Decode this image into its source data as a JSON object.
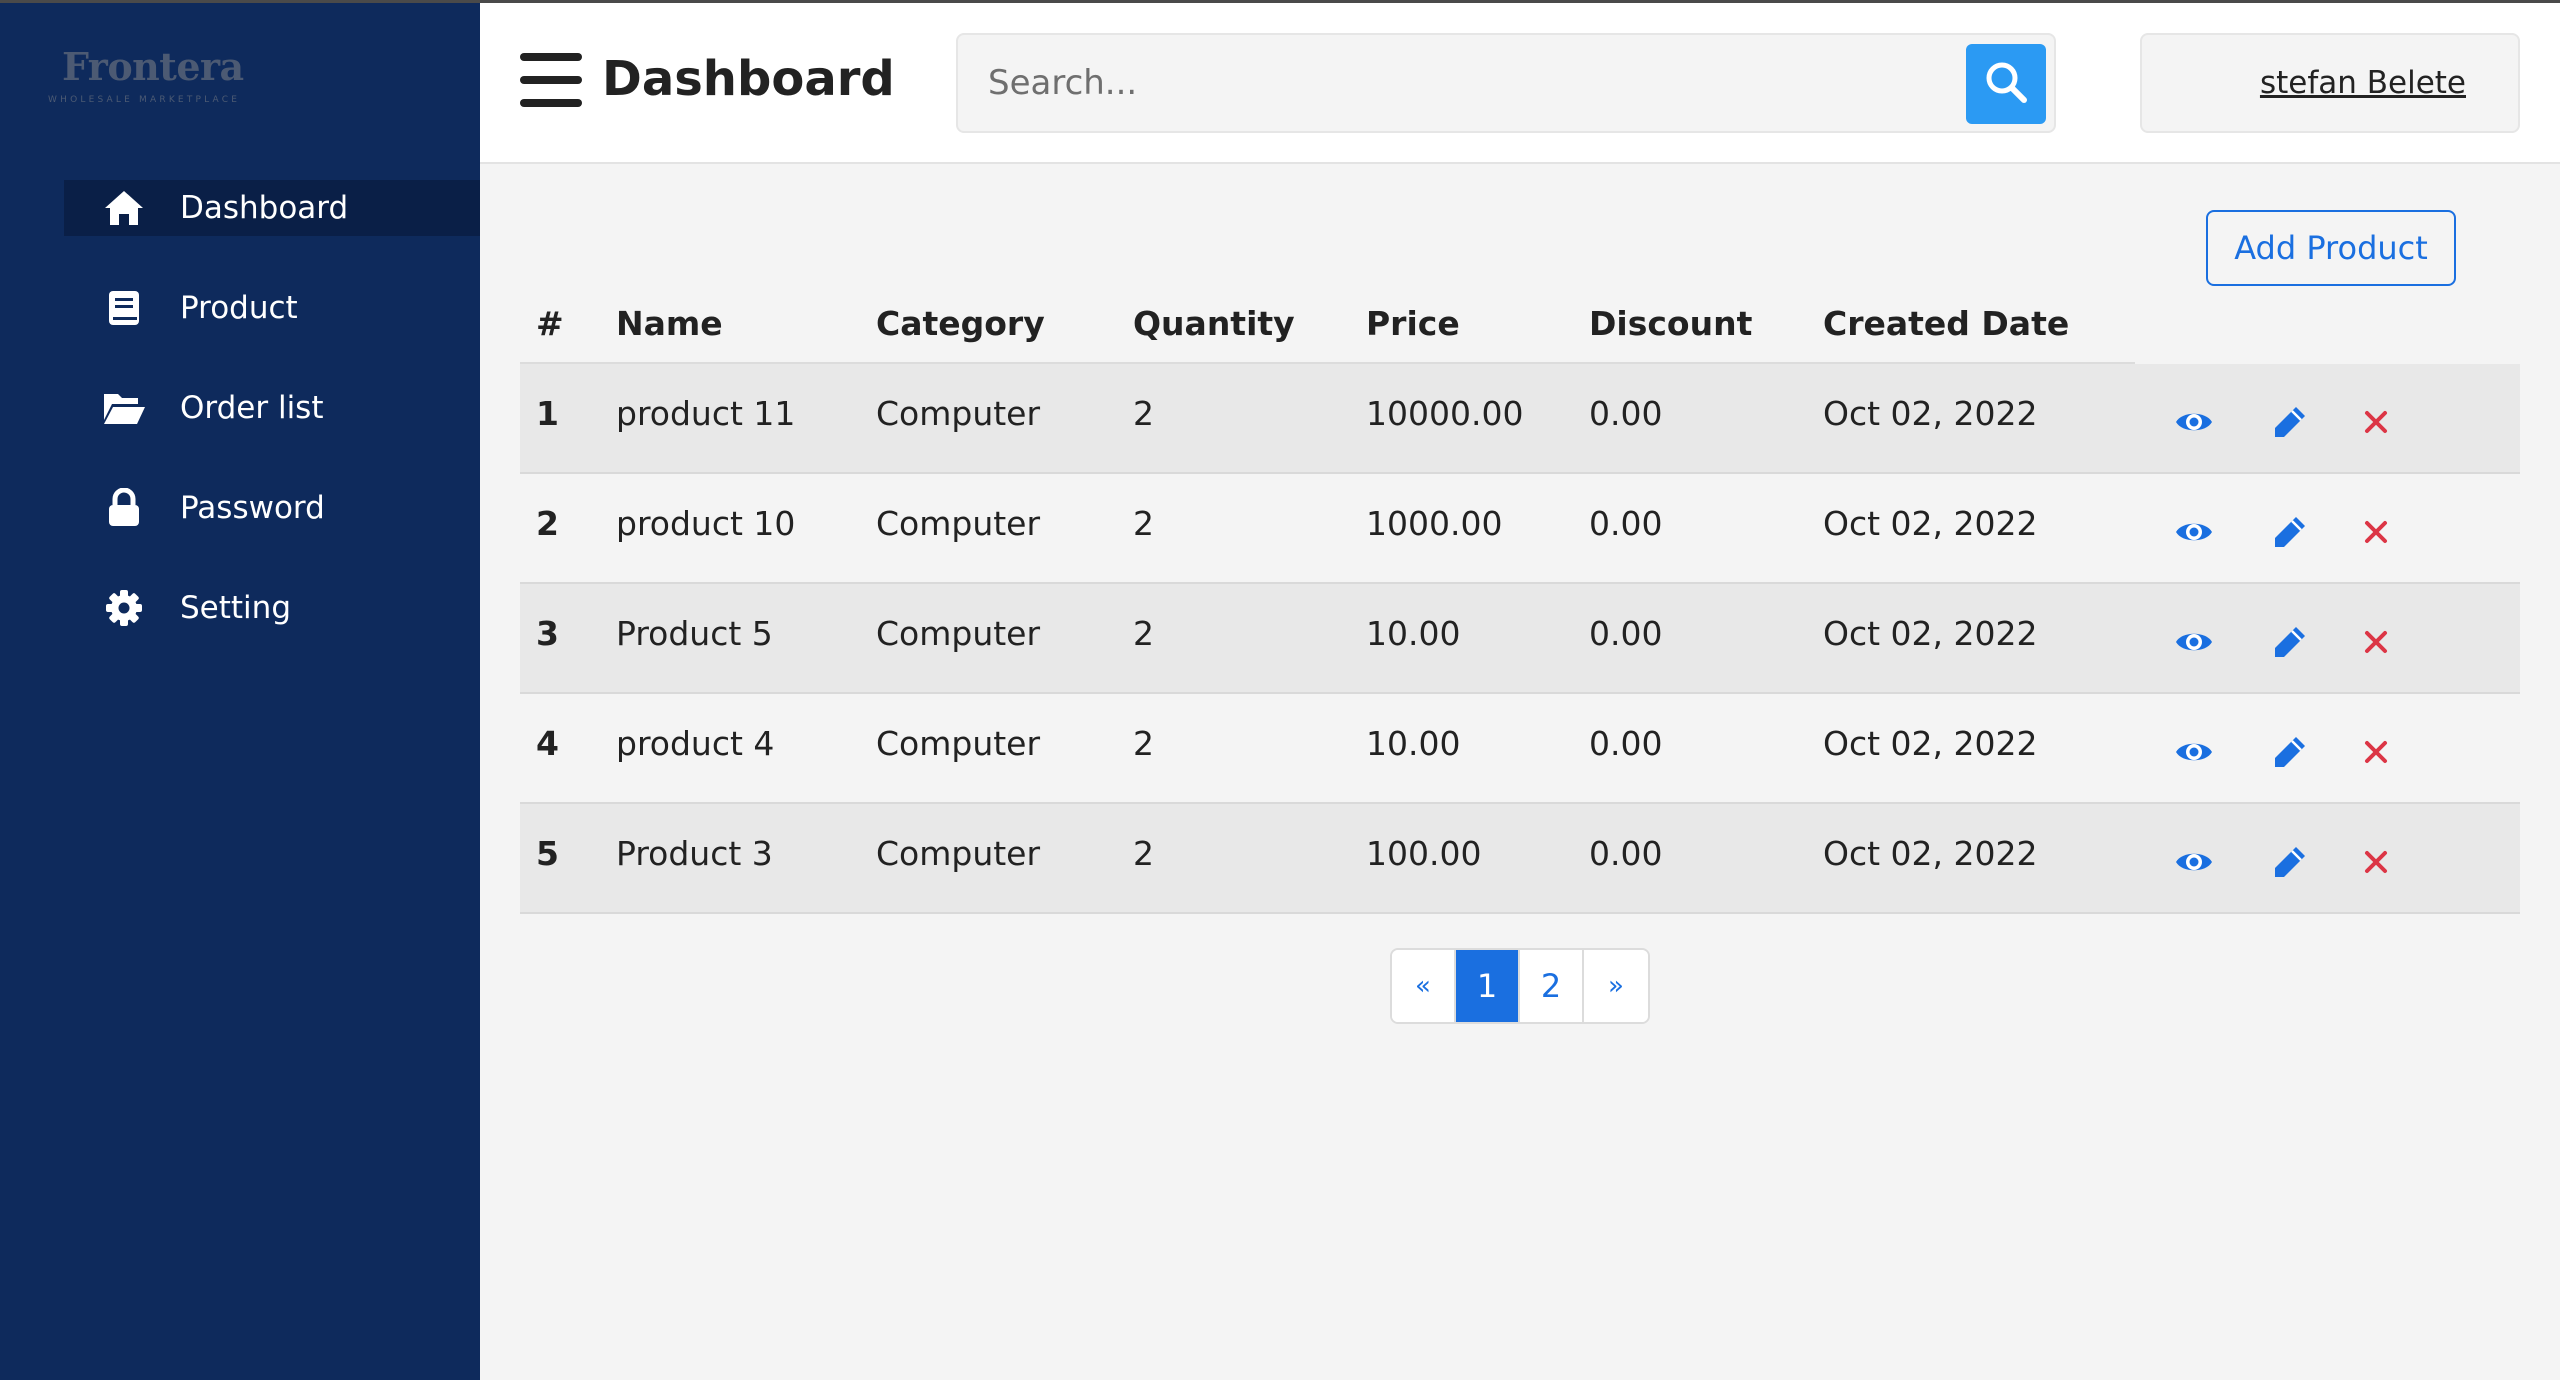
{
  "brand": {
    "name": "Frontera",
    "tagline": "WHOLESALE MARKETPLACE"
  },
  "sidebar": {
    "items": [
      {
        "label": "Dashboard",
        "icon": "home-icon",
        "active": true
      },
      {
        "label": "Product",
        "icon": "book-icon",
        "active": false
      },
      {
        "label": "Order list",
        "icon": "folder-open-icon",
        "active": false
      },
      {
        "label": "Password",
        "icon": "lock-icon",
        "active": false
      },
      {
        "label": "Setting",
        "icon": "gear-icon",
        "active": false
      }
    ]
  },
  "header": {
    "title": "Dashboard",
    "search_placeholder": "Search...",
    "user_name": "stefan Belete"
  },
  "toolbar": {
    "add_label": "Add Product"
  },
  "table": {
    "headers": [
      "#",
      "Name",
      "Category",
      "Quantity",
      "Price",
      "Discount",
      "Created Date"
    ],
    "rows": [
      {
        "idx": "1",
        "name": "product 11",
        "category": "Computer",
        "quantity": "2",
        "price": "10000.00",
        "discount": "0.00",
        "date": "Oct 02, 2022"
      },
      {
        "idx": "2",
        "name": "product 10",
        "category": "Computer",
        "quantity": "2",
        "price": "1000.00",
        "discount": "0.00",
        "date": "Oct 02, 2022"
      },
      {
        "idx": "3",
        "name": "Product 5",
        "category": "Computer",
        "quantity": "2",
        "price": "10.00",
        "discount": "0.00",
        "date": "Oct 02, 2022"
      },
      {
        "idx": "4",
        "name": "product 4",
        "category": "Computer",
        "quantity": "2",
        "price": "10.00",
        "discount": "0.00",
        "date": "Oct 02, 2022"
      },
      {
        "idx": "5",
        "name": "Product 3",
        "category": "Computer",
        "quantity": "2",
        "price": "100.00",
        "discount": "0.00",
        "date": "Oct 02, 2022"
      }
    ],
    "row_actions": [
      "view-icon",
      "edit-icon",
      "delete-icon"
    ]
  },
  "pagination": {
    "prev": "«",
    "pages": [
      "1",
      "2"
    ],
    "current": "1",
    "next": "»"
  },
  "colors": {
    "sidebar_bg": "#0e2a5c",
    "sidebar_active_bg": "#0a1f47",
    "accent_blue": "#1a6fe0",
    "search_button": "#2b9af3",
    "delete_red": "#dc3545"
  }
}
